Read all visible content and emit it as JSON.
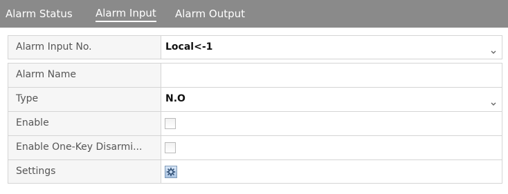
{
  "tabs": [
    {
      "label": "Alarm Status",
      "active": false
    },
    {
      "label": "Alarm Input",
      "active": true
    },
    {
      "label": "Alarm Output",
      "active": false
    }
  ],
  "form": {
    "alarm_input_no": {
      "label": "Alarm Input No.",
      "value": "Local<-1"
    },
    "alarm_name": {
      "label": "Alarm Name",
      "value": ""
    },
    "type": {
      "label": "Type",
      "value": "N.O"
    },
    "enable": {
      "label": "Enable",
      "checked": false
    },
    "enable_one_key_disarm": {
      "label": "Enable One-Key Disarmi...",
      "checked": false
    },
    "settings": {
      "label": "Settings",
      "icon": "gear-icon"
    }
  },
  "colors": {
    "tab_bar": "#8a8a8a",
    "label_bg": "#f6f6f6",
    "border": "#d4d4d4"
  }
}
